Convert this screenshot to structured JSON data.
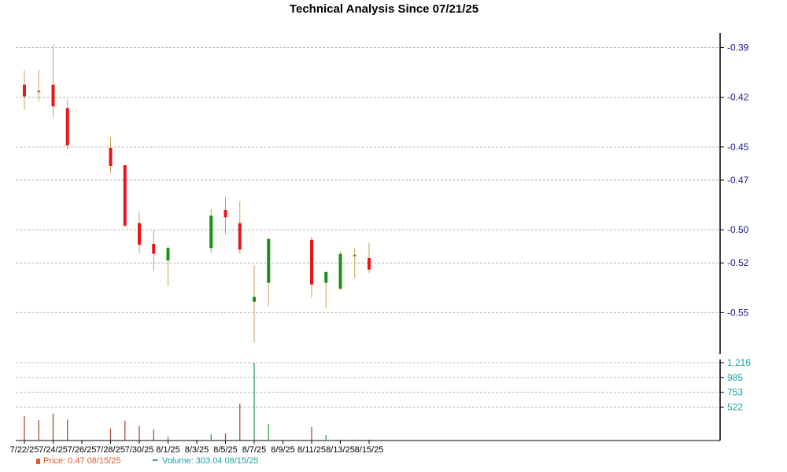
{
  "chart_data": {
    "type": "candlestick",
    "title": "Technical Analysis Since 07/21/25",
    "price_axis": {
      "ticks": [
        "-0.39",
        "-0.42",
        "-0.45",
        "-0.47",
        "-0.50",
        "-0.52",
        "-0.55"
      ],
      "ylim": [
        -0.575,
        -0.385
      ]
    },
    "volume_axis": {
      "ticks": [
        "1,216",
        "985",
        "753",
        "522"
      ],
      "ylim": [
        0,
        1216
      ]
    },
    "x_ticks": [
      "7/22/25",
      "7/24/25",
      "7/26/25",
      "7/28/25",
      "7/30/25",
      "8/1/25",
      "8/3/25",
      "8/5/25",
      "8/7/25",
      "8/9/25",
      "8/11/25",
      "8/13/25",
      "8/15/25"
    ],
    "candles": [
      {
        "date": "7/22/25",
        "open": -0.4124,
        "high": -0.4035,
        "low": -0.4275,
        "close": -0.4195,
        "volume": 380,
        "dir": "down"
      },
      {
        "date": "7/23/25",
        "open": -0.416,
        "high": -0.4035,
        "low": -0.4225,
        "close": -0.4166,
        "volume": 320,
        "dir": "flat"
      },
      {
        "date": "7/24/25",
        "open": -0.4124,
        "high": -0.388,
        "low": -0.432,
        "close": -0.4255,
        "volume": 420,
        "dir": "down"
      },
      {
        "date": "7/25/25",
        "open": -0.4265,
        "high": -0.4215,
        "low": -0.4515,
        "close": -0.449,
        "volume": 325,
        "dir": "down"
      },
      {
        "date": "7/28/25",
        "open": -0.4505,
        "high": -0.444,
        "low": -0.466,
        "close": -0.4615,
        "volume": 190,
        "dir": "down"
      },
      {
        "date": "7/29/25",
        "open": -0.461,
        "high": -0.461,
        "low": -0.4985,
        "close": -0.4975,
        "volume": 310,
        "dir": "down"
      },
      {
        "date": "7/30/25",
        "open": -0.496,
        "high": -0.489,
        "low": -0.514,
        "close": -0.509,
        "volume": 230,
        "dir": "down"
      },
      {
        "date": "7/31/25",
        "open": -0.5085,
        "high": -0.5,
        "low": -0.5245,
        "close": -0.5145,
        "volume": 170,
        "dir": "down"
      },
      {
        "date": "8/1/25",
        "open": -0.5185,
        "high": -0.51,
        "low": -0.534,
        "close": -0.511,
        "volume": 60,
        "dir": "up"
      },
      {
        "date": "8/4/25",
        "open": -0.511,
        "high": -0.4875,
        "low": -0.514,
        "close": -0.4915,
        "volume": 100,
        "dir": "up"
      },
      {
        "date": "8/5/25",
        "open": -0.488,
        "high": -0.4805,
        "low": -0.5025,
        "close": -0.4925,
        "volume": 110,
        "dir": "down"
      },
      {
        "date": "8/6/25",
        "open": -0.496,
        "high": -0.483,
        "low": -0.5145,
        "close": -0.512,
        "volume": 575,
        "dir": "down"
      },
      {
        "date": "8/7/25",
        "open": -0.5435,
        "high": -0.5215,
        "low": -0.568,
        "close": -0.5405,
        "volume": 1216,
        "dir": "up"
      },
      {
        "date": "8/8/25",
        "open": -0.532,
        "high": -0.505,
        "low": -0.546,
        "close": -0.5055,
        "volume": 260,
        "dir": "up"
      },
      {
        "date": "8/11/25",
        "open": -0.506,
        "high": -0.504,
        "low": -0.541,
        "close": -0.533,
        "volume": 210,
        "dir": "down"
      },
      {
        "date": "8/12/25",
        "open": -0.532,
        "high": -0.5255,
        "low": -0.5475,
        "close": -0.5255,
        "volume": 85,
        "dir": "up"
      },
      {
        "date": "8/13/25",
        "open": -0.5355,
        "high": -0.513,
        "low": -0.5365,
        "close": -0.5145,
        "volume": 15,
        "dir": "up"
      },
      {
        "date": "8/14/25",
        "open": -0.515,
        "high": -0.511,
        "low": -0.529,
        "close": -0.516,
        "volume": 15,
        "dir": "flat"
      },
      {
        "date": "8/15/25",
        "open": -0.517,
        "high": -0.508,
        "low": -0.526,
        "close": -0.524,
        "volume": 15,
        "dir": "down"
      }
    ],
    "grid": true,
    "legend": {
      "position": "bottom-left",
      "price_label": "Price: 0.47  08/15/25",
      "volume_label": "Volume: 303.04  08/15/25"
    },
    "colors": {
      "down": "#e8151b",
      "up": "#1a8f1a",
      "wick": "#c8a050",
      "vol_up": "#2e9e5a",
      "vol_down": "#b0482f",
      "price_axis": "#1a1a8c",
      "volume_axis": "#1aa3a3"
    }
  }
}
